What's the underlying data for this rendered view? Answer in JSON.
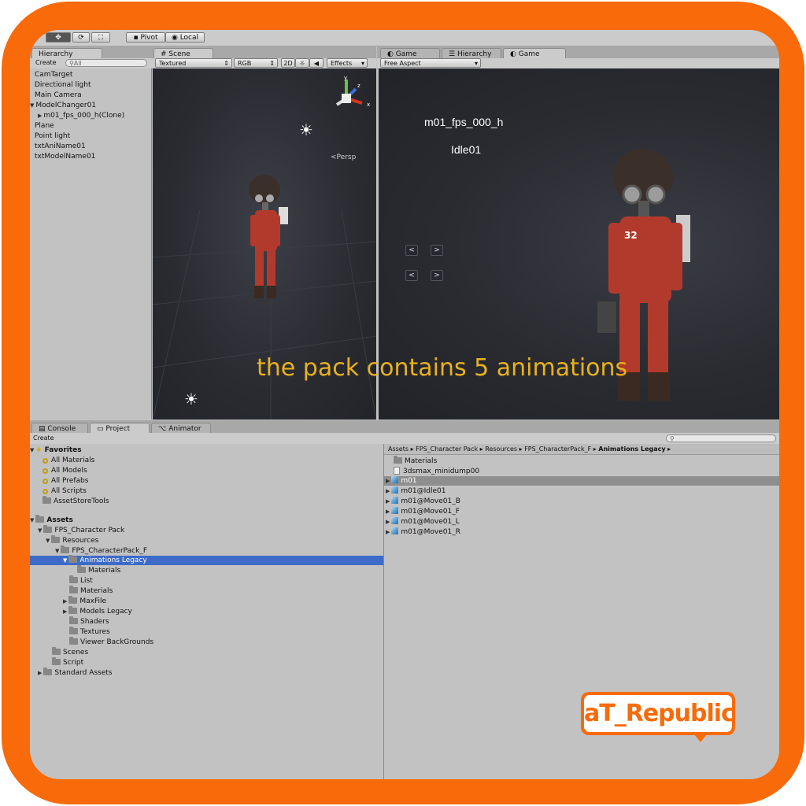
{
  "toolbar": {
    "pivot": "Pivot",
    "local": "Local"
  },
  "hierarchy": {
    "tab": "Hierarchy",
    "create": "Create",
    "search_placeholder": "All",
    "items": [
      "CamTarget",
      "Directional light",
      "Main Camera",
      "ModelChanger01",
      "m01_fps_000_h(Clone)",
      "Plane",
      "Point light",
      "txtAniName01",
      "txtModelName01"
    ]
  },
  "scene": {
    "tab": "Scene",
    "shading": "Textured",
    "channel": "RGB",
    "mode2d": "2D",
    "effects": "Effects",
    "persp": "Persp"
  },
  "game": {
    "tab_left": "Game",
    "tab_hierarchy": "Hierarchy",
    "tab_right": "Game",
    "aspect": "Free Aspect",
    "model_name": "m01_fps_000_h",
    "anim_name": "Idle01",
    "prev": "<",
    "next": ">"
  },
  "caption": "the pack contains 5 animations",
  "bottom_tabs": {
    "console": "Console",
    "project": "Project",
    "animator": "Animator"
  },
  "project": {
    "create": "Create",
    "favorites_label": "Favorites",
    "favorites": [
      "All Materials",
      "All Models",
      "All Prefabs",
      "All Scripts",
      "AssetStoreTools"
    ],
    "assets_label": "Assets",
    "tree": [
      "FPS_Character Pack",
      "Resources",
      "FPS_CharacterPack_F",
      "Animations Legacy",
      "Materials",
      "List",
      "Materials",
      "MaxFile",
      "Models Legacy",
      "Shaders",
      "Textures",
      "Viewer BackGrounds",
      "Scenes",
      "Script",
      "Standard Assets"
    ],
    "breadcrumb": [
      "Assets",
      "FPS_Character Pack",
      "Resources",
      "FPS_CharacterPack_F",
      "Animations Legacy"
    ],
    "files": [
      "Materials",
      "3dsmax_minidump00",
      "m01",
      "m01@Idle01",
      "m01@Move01_B",
      "m01@Move01_F",
      "m01@Move01_L",
      "m01@Move01_R"
    ]
  },
  "logo": "aT_Republic",
  "colors": {
    "frame": "#f96a0a",
    "caption": "#e8b21e",
    "selection": "#3d6bc7",
    "viewport": "#2a2b31"
  }
}
